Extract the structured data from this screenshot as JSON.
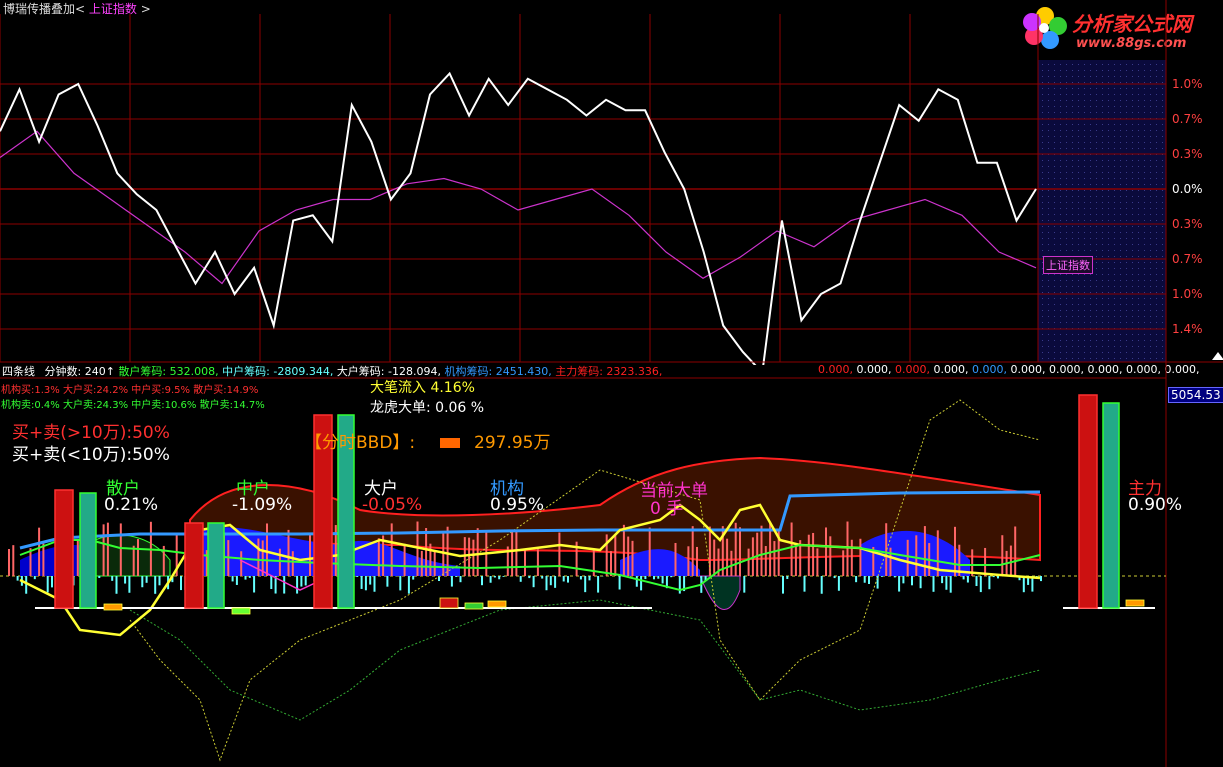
{
  "title_bar": {
    "stock_name": "博瑞传播叠加",
    "open_bracket": "<",
    "overlay_name": "上证指数",
    "close_bracket": ">"
  },
  "watermark": {
    "brand": "分析家公式网",
    "site": "www.88gs.com"
  },
  "top_chart": {
    "overlay_tag": "上证指数",
    "right_axis_labels": [
      "1.0%",
      "0.7%",
      "0.3%",
      "0.0%",
      "0.3%",
      "0.7%",
      "1.0%",
      "1.4%"
    ],
    "colors": {
      "price": "#ffffff",
      "index": "#cc33cc",
      "grid": "#8b0000",
      "future_shade": "#0a0a3c"
    }
  },
  "indicator_header": {
    "name": "四条线",
    "fenzhong_label": "分钟数:",
    "fenzhong_value": "240↑",
    "sanhu_label": "散户筹码:",
    "sanhu_value": "532.008,",
    "zhonghu_label": "中户筹码:",
    "zhonghu_value": "-2809.344,",
    "dahu_label": "大户筹码:",
    "dahu_value": "-128.094,",
    "jigou_label": "机构筹码:",
    "jigou_value": "2451.430,",
    "zhuli_label": "主力筹码:",
    "zhuli_value": "2323.336,",
    "trailing": [
      "0.000,",
      "0.000,",
      "0.000,",
      "0.000,",
      "0.000,",
      "0.000,",
      "0.000,",
      "0.000,",
      "0.000,",
      "0.000,"
    ]
  },
  "buy_line": "机构买:1.3% 大户买:24.2% 中户买:9.5% 散户买:14.9%",
  "sell_line": "机构卖:0.4% 大户卖:24.3% 中户卖:10.6% 散户卖:14.7%",
  "big_order_inflow": "大笔流入  4.16%",
  "dragon_tiger": "龙虎大单: 0.06 %",
  "buy_sell_big": "买+卖(>10万):50%",
  "buy_sell_small": "买+卖(<10万):50%",
  "bbd_label": "【分时BBD】:",
  "bbd_value": "297.95万",
  "current_big_order": "当前大单",
  "current_big_order_value": "0  手",
  "groups": [
    {
      "name": "散户",
      "value": "0.21%"
    },
    {
      "name": "中户",
      "value": "-1.09%"
    },
    {
      "name": "大户",
      "value": "-0.05%"
    },
    {
      "name": "机构",
      "value": "0.95%"
    }
  ],
  "zhuli": {
    "name": "主力",
    "value": "0.90%"
  },
  "price_tag": "5054.53",
  "colors": {
    "red": "#ff2020",
    "green": "#33ff33",
    "yellow": "#ffff33",
    "blue": "#3399ff",
    "cyan": "#66ffff",
    "magenta": "#ff33cc",
    "white": "#ffffff",
    "orange": "#ff9900"
  },
  "chart_data": [
    {
      "type": "line",
      "series": [
        {
          "values": [
            0.55,
            0.95,
            0.45,
            0.9,
            1.0,
            0.6,
            0.15,
            -0.05,
            -0.2,
            -0.55,
            -0.9,
            -0.6,
            -1.0,
            -0.75,
            -1.3,
            -0.3,
            -0.25,
            -0.5,
            0.8,
            0.45,
            -0.1,
            0.15,
            0.9,
            1.1,
            0.7,
            1.05,
            0.8,
            1.05,
            0.95,
            0.85,
            0.7,
            0.85,
            0.75,
            0.75,
            0.35,
            0.0,
            -0.6,
            -1.3,
            -1.55,
            -1.75,
            -0.3,
            -1.25,
            -1.0,
            -0.9,
            -0.3,
            0.25,
            0.8,
            0.65,
            0.95,
            0.85,
            0.25,
            0.25,
            -0.3,
            0.0
          ]
        },
        {
          "values": [
            0.3,
            0.55,
            0.15,
            -0.1,
            -0.35,
            -0.6,
            -0.9,
            -0.4,
            -0.2,
            -0.1,
            -0.1,
            0.05,
            0.1,
            0.0,
            -0.2,
            -0.1,
            0.0,
            -0.25,
            -0.6,
            -0.85,
            -0.65,
            -0.4,
            -0.55,
            -0.3,
            -0.2,
            -0.1,
            -0.25,
            -0.6,
            -0.75
          ]
        }
      ]
    },
    {
      "type": "line",
      "series": [
        {
          "values": [
            0.5,
            0.9,
            1.2,
            1.3,
            1.4,
            1.5,
            1.6,
            1.7,
            1.8,
            1.8,
            1.8,
            1.8,
            1.9
          ]
        },
        {
          "values": [
            0.2,
            0.3,
            0.6,
            0.4,
            0.4,
            0.5,
            0.6,
            0.5,
            0.4,
            0.5,
            0.3,
            0.2,
            0.6,
            0.2
          ]
        },
        {
          "values": [
            -0.6,
            -0.7,
            -0.2,
            0.5,
            0.1,
            0.2,
            0.3,
            0.4,
            0.3,
            1.0,
            1.3,
            0.6,
            0.2,
            0.1
          ]
        }
      ]
    }
  ]
}
